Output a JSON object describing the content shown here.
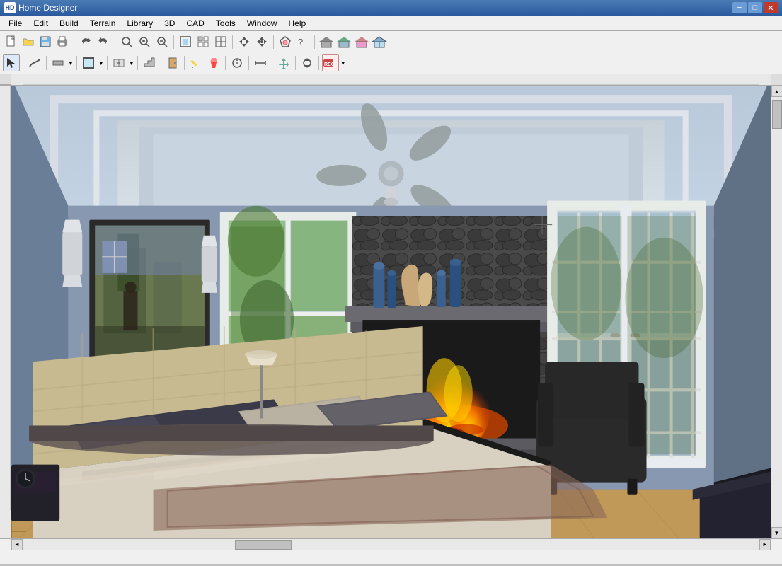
{
  "app": {
    "title": "Home Designer",
    "icon": "HD"
  },
  "window_controls": {
    "minimize": "−",
    "maximize": "□",
    "close": "✕"
  },
  "menu": {
    "items": [
      {
        "label": "File",
        "id": "file"
      },
      {
        "label": "Edit",
        "id": "edit"
      },
      {
        "label": "Build",
        "id": "build"
      },
      {
        "label": "Terrain",
        "id": "terrain"
      },
      {
        "label": "Library",
        "id": "library"
      },
      {
        "label": "3D",
        "id": "3d"
      },
      {
        "label": "CAD",
        "id": "cad"
      },
      {
        "label": "Tools",
        "id": "tools"
      },
      {
        "label": "Window",
        "id": "window"
      },
      {
        "label": "Help",
        "id": "help"
      }
    ]
  },
  "toolbar1": {
    "buttons": [
      {
        "icon": "📄",
        "name": "new",
        "tooltip": "New"
      },
      {
        "icon": "📂",
        "name": "open",
        "tooltip": "Open"
      },
      {
        "icon": "💾",
        "name": "save",
        "tooltip": "Save"
      },
      {
        "icon": "🖨️",
        "name": "print",
        "tooltip": "Print"
      },
      {
        "icon": "↩",
        "name": "undo",
        "tooltip": "Undo"
      },
      {
        "icon": "↪",
        "name": "redo",
        "tooltip": "Redo"
      },
      {
        "icon": "🔍",
        "name": "zoom",
        "tooltip": "Zoom"
      },
      {
        "icon": "⊕",
        "name": "zoom-in",
        "tooltip": "Zoom In"
      },
      {
        "icon": "⊖",
        "name": "zoom-out",
        "tooltip": "Zoom Out"
      },
      {
        "icon": "⛶",
        "name": "fit",
        "tooltip": "Fit"
      },
      {
        "icon": "⊞",
        "name": "grid",
        "tooltip": "Grid"
      },
      {
        "icon": "?",
        "name": "help",
        "tooltip": "Help"
      }
    ]
  },
  "toolbar2": {
    "buttons": [
      {
        "icon": "↖",
        "name": "select",
        "tooltip": "Select"
      },
      {
        "icon": "〜",
        "name": "spline",
        "tooltip": "Spline"
      },
      {
        "icon": "⊢",
        "name": "wall",
        "tooltip": "Wall"
      },
      {
        "icon": "▦",
        "name": "room",
        "tooltip": "Room"
      },
      {
        "icon": "⌂",
        "name": "roof",
        "tooltip": "Roof"
      },
      {
        "icon": "⊡",
        "name": "floor",
        "tooltip": "Floor"
      },
      {
        "icon": "⊟",
        "name": "door",
        "tooltip": "Door"
      },
      {
        "icon": "↑",
        "name": "stair",
        "tooltip": "Stair"
      },
      {
        "icon": "✏",
        "name": "draw",
        "tooltip": "Draw"
      },
      {
        "icon": "🎨",
        "name": "material",
        "tooltip": "Material"
      },
      {
        "icon": "⊙",
        "name": "library",
        "tooltip": "Library"
      },
      {
        "icon": "✦",
        "name": "dimension",
        "tooltip": "Dimension"
      },
      {
        "icon": "⬆",
        "name": "move",
        "tooltip": "Move"
      },
      {
        "icon": "⊕",
        "name": "transform",
        "tooltip": "Transform"
      },
      {
        "icon": "⏺",
        "name": "record",
        "tooltip": "Record"
      }
    ]
  },
  "canvas": {
    "background_color": "#7a9dbf",
    "description": "3D bedroom view with fireplace"
  },
  "status_bar": {
    "text": ""
  }
}
